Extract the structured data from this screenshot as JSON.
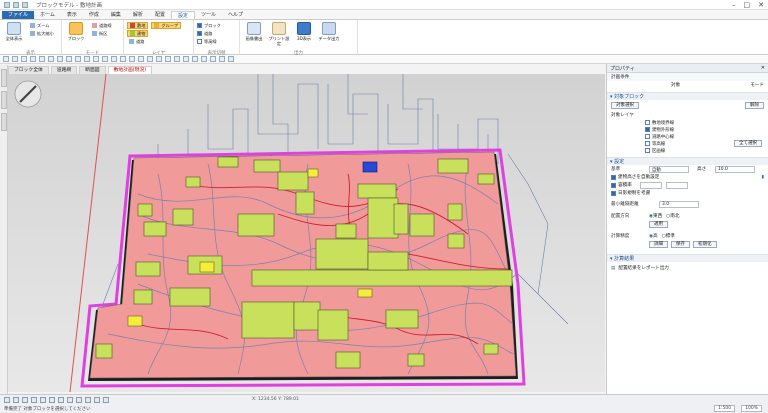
{
  "window": {
    "title": "ブロックモデル - 敷地計画",
    "minimize": "–",
    "maximize": "□",
    "close": "✕"
  },
  "ribbon": {
    "tabs": [
      "ファイル",
      "ホーム",
      "表示",
      "作成",
      "編集",
      "解析",
      "配置",
      "設定",
      "ツール",
      "ヘルプ"
    ],
    "active_tab": 7,
    "groups": [
      {
        "label": "表示",
        "buttons": [
          "全体表示",
          "ズーム",
          "拡大縮小"
        ]
      },
      {
        "label": "モード",
        "active_button": "ブロック",
        "items": [
          "ブロック",
          "道路線",
          "街区"
        ]
      },
      {
        "label": "レイヤ",
        "items": [
          "敷地",
          "建物",
          "道路",
          "グループ"
        ]
      },
      {
        "label": "表示切替",
        "checks": [
          {
            "label": "ブロック",
            "on": true
          },
          {
            "label": "道路",
            "on": true
          },
          {
            "label": "等高線",
            "on": false
          }
        ]
      },
      {
        "label": "出力",
        "buttons": [
          "画像書出",
          "プリント設定",
          "3D表示",
          "データ出力"
        ]
      }
    ]
  },
  "doc_tabs": [
    "ブロック全体",
    "道路網",
    "断面図",
    "敷地計画(現況)"
  ],
  "active_doc_tab": 3,
  "panel": {
    "title": "プロパティ",
    "close": "✕",
    "subtitle": "計画条件",
    "col1": "対象",
    "col2": "モード",
    "sections": [
      {
        "title": "▾ 対象ブロック",
        "button": "対象選択",
        "button2": "解除",
        "checks_label": "対象レイヤ",
        "checks": [
          {
            "label": "敷地境界線",
            "on": false
          },
          {
            "label": "建物外形線",
            "on": true
          },
          {
            "label": "道路中心線",
            "on": false
          },
          {
            "label": "等高線",
            "on": false
          },
          {
            "label": "区画線",
            "on": false
          }
        ],
        "apply": "全て選択"
      },
      {
        "title": "▾ 設定",
        "rows": [
          {
            "label": "基準",
            "value": "自動"
          },
          {
            "label": "高さ",
            "value": "10.0"
          }
        ],
        "checks": [
          {
            "label": "建物高さを自動設定",
            "on": true
          },
          {
            "label": "容積率",
            "on": true
          },
          {
            "label": "日影規制を考慮",
            "on": true
          }
        ],
        "fields": [
          {
            "label": "最小離隔距離",
            "value": "3.0"
          },
          {
            "label": "配置方向",
            "options": [
              "東西",
              "南北"
            ],
            "selected": 0,
            "button": "適用"
          },
          {
            "label": "計算精度",
            "options": [
              "高",
              "標準"
            ],
            "selected": 0,
            "buttons": [
              "詳細",
              "保存",
              "初期化"
            ]
          }
        ]
      },
      {
        "title": "▾ 計算結果",
        "note": "配置結果をレポート出力"
      }
    ]
  },
  "status": {
    "coords": "X: 1234.56  Y: 789.01",
    "message": "準備完了  対象ブロックを選択してください",
    "scale": "1:500",
    "zoom": "100%"
  }
}
